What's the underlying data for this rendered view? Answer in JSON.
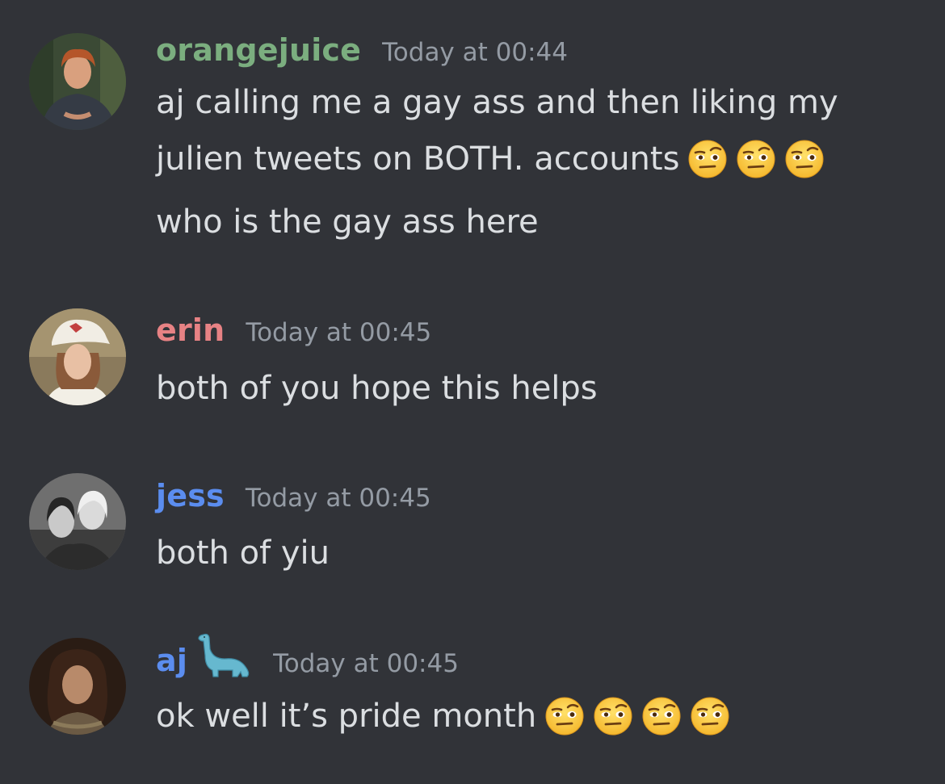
{
  "messages": [
    {
      "username": "orangejuice",
      "username_color": "#7bae7f",
      "timestamp": "Today at 00:44",
      "avatar": "avatar-orangejuice",
      "lines": [
        "aj calling me a gay ass and then liking my",
        "julien tweets on BOTH. accounts",
        "who is the gay ass here"
      ],
      "emoji": "face-with-raised-eyebrow-emoji"
    },
    {
      "username": "erin",
      "username_color": "#e78284",
      "timestamp": "Today at 00:45",
      "avatar": "avatar-erin",
      "lines": [
        "both of you hope this helps"
      ]
    },
    {
      "username": "jess",
      "username_color": "#5b8def",
      "timestamp": "Today at 00:45",
      "avatar": "avatar-jess",
      "lines": [
        "both of yiu"
      ]
    },
    {
      "username": "aj",
      "username_color": "#5b8def",
      "username_icon": "sauropod-icon",
      "timestamp": "Today at 00:45",
      "avatar": "avatar-aj",
      "lines": [
        "ok well it’s pride month"
      ],
      "emoji": "face-with-raised-eyebrow-emoji"
    }
  ]
}
